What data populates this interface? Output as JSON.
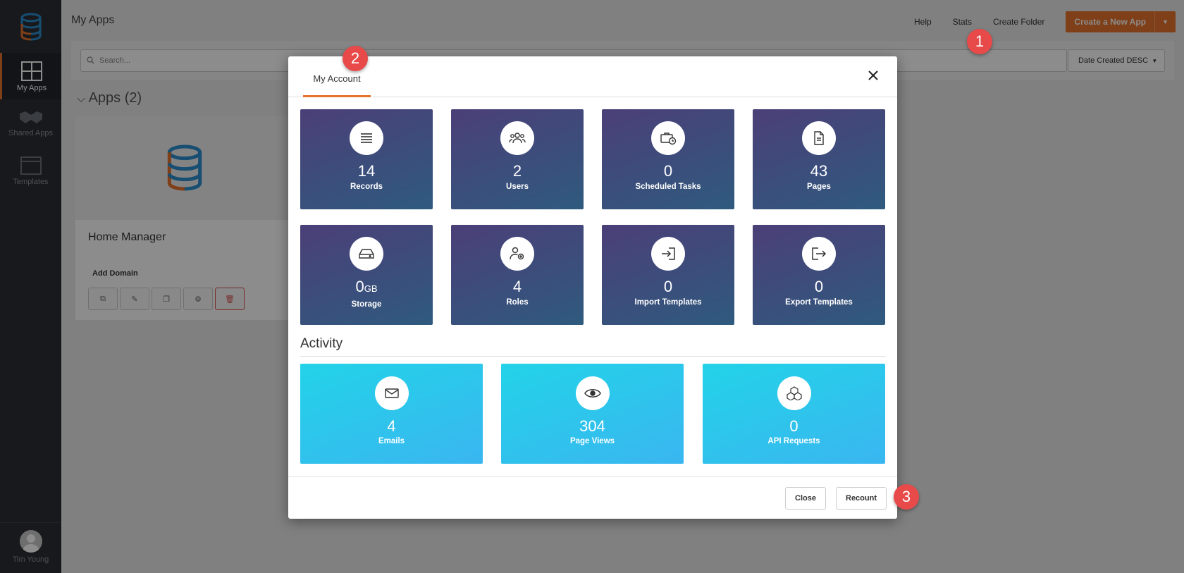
{
  "sidebar": {
    "items": [
      {
        "label": "My Apps",
        "icon": "grid-icon",
        "active": true
      },
      {
        "label": "Shared Apps",
        "icon": "handshake-icon"
      },
      {
        "label": "Templates",
        "icon": "window-icon"
      }
    ],
    "user": {
      "name": "Tim Young"
    }
  },
  "header": {
    "title": "My Apps",
    "nav": [
      "Help",
      "Stats",
      "Create Folder"
    ],
    "create_label": "Create a New App"
  },
  "filters": {
    "search_placeholder": "Search...",
    "sort_label": "Date Created DESC"
  },
  "apps": {
    "heading": "Apps (2)",
    "card": {
      "name": "Home Manager",
      "add_domain": "Add Domain"
    }
  },
  "modal": {
    "tab": "My Account",
    "stats": [
      {
        "value": "14",
        "label": "Records",
        "icon": "list-icon"
      },
      {
        "value": "2",
        "label": "Users",
        "icon": "users-icon"
      },
      {
        "value": "0",
        "label": "Scheduled Tasks",
        "icon": "briefcase-clock-icon"
      },
      {
        "value": "43",
        "label": "Pages",
        "icon": "document-icon"
      },
      {
        "value": "0",
        "unit": "GB",
        "label": "Storage",
        "icon": "drive-icon"
      },
      {
        "value": "4",
        "label": "Roles",
        "icon": "user-gear-icon"
      },
      {
        "value": "0",
        "label": "Import Templates",
        "icon": "sign-in-icon"
      },
      {
        "value": "0",
        "label": "Export Templates",
        "icon": "sign-out-icon"
      }
    ],
    "activity_title": "Activity",
    "activity": [
      {
        "value": "4",
        "label": "Emails",
        "icon": "envelope-icon"
      },
      {
        "value": "304",
        "label": "Page Views",
        "icon": "eye-icon"
      },
      {
        "value": "0",
        "label": "API Requests",
        "icon": "cubes-icon"
      }
    ],
    "close_label": "Close",
    "recount_label": "Recount"
  },
  "badges": [
    "1",
    "2",
    "3"
  ],
  "colors": {
    "accent": "#e8732c",
    "badge": "#e84a4a",
    "tile_start": "#4b3f78",
    "tile_end": "#2f5a7e",
    "activity_start": "#22d3e8",
    "activity_end": "#3ab6f0"
  }
}
